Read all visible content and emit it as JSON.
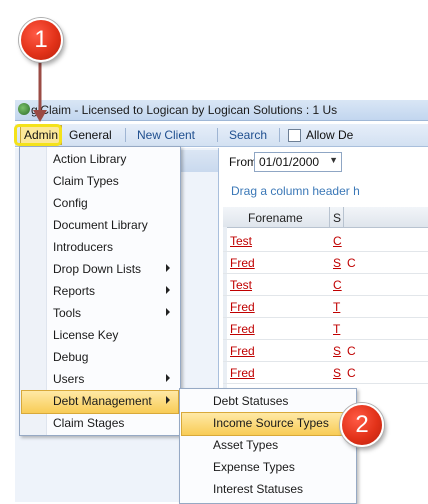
{
  "window": {
    "title": "giClaim - Licensed to Logican by Logican Solutions : 1 Us"
  },
  "menubar": {
    "admin": "Admin",
    "general": "General",
    "new_client": "New Client",
    "search": "Search",
    "allow": "Allow De"
  },
  "filter": {
    "from_label": "From",
    "from_value": "01/01/2000"
  },
  "grid": {
    "drag_hint": "Drag a column header h",
    "columns": [
      "Forename",
      "S"
    ],
    "rows": [
      {
        "name": "Test",
        "s": "C",
        "c": ""
      },
      {
        "name": "Fred",
        "s": "S",
        "c": "C"
      },
      {
        "name": "Test",
        "s": "C",
        "c": ""
      },
      {
        "name": "Fred",
        "s": "T",
        "c": ""
      },
      {
        "name": "Fred",
        "s": "T",
        "c": ""
      },
      {
        "name": "Fred",
        "s": "S",
        "c": "C"
      },
      {
        "name": "Fred",
        "s": "S",
        "c": "C"
      }
    ]
  },
  "admin_menu": {
    "items": [
      {
        "label": "Action Library",
        "submenu": false
      },
      {
        "label": "Claim Types",
        "submenu": false
      },
      {
        "label": "Config",
        "submenu": false
      },
      {
        "label": "Document Library",
        "submenu": false
      },
      {
        "label": "Introducers",
        "submenu": false
      },
      {
        "label": "Drop Down Lists",
        "submenu": true
      },
      {
        "label": "Reports",
        "submenu": true
      },
      {
        "label": "Tools",
        "submenu": true
      },
      {
        "label": "License Key",
        "submenu": false
      },
      {
        "label": "Debug",
        "submenu": false
      },
      {
        "label": "Users",
        "submenu": true
      },
      {
        "label": "Debt Management",
        "submenu": true
      },
      {
        "label": "Claim Stages",
        "submenu": false
      }
    ],
    "highlighted": "Debt Management"
  },
  "debt_submenu": {
    "items": [
      {
        "label": "Debt Statuses"
      },
      {
        "label": "Income Source Types"
      },
      {
        "label": "Asset Types"
      },
      {
        "label": "Expense Types"
      },
      {
        "label": "Interest Statuses"
      }
    ],
    "highlighted": "Income Source Types"
  },
  "callouts": {
    "step1": "1",
    "step2": "2"
  },
  "colors": {
    "callout": "#e23219",
    "highlight": "#f8cc56",
    "link_red": "#c00000",
    "admin_ring": "#f4e21a"
  }
}
